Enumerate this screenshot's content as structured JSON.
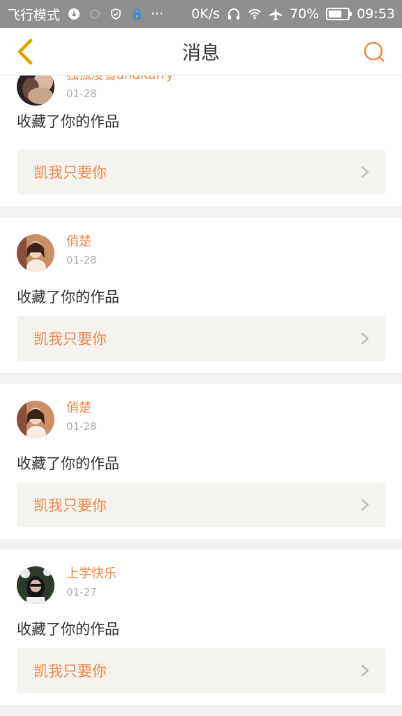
{
  "status_bar": {
    "mode": "飞行模式",
    "net_speed": "0K/s",
    "battery": "70%",
    "time": "09:53",
    "battery_level": 0.7
  },
  "header": {
    "title": "消息"
  },
  "colors": {
    "accent": "#f08a4b",
    "back_icon": "#f0b400"
  },
  "notifications": [
    {
      "user": "独孤凌雪andKarry",
      "date": "01-28",
      "action": "收藏了你的作品",
      "work": "凯我只要你",
      "avatar": "avatar-photo-dark"
    },
    {
      "user": "俏楚",
      "date": "01-28",
      "action": "收藏了你的作品",
      "work": "凯我只要你",
      "avatar": "avatar-photo-warm"
    },
    {
      "user": "俏楚",
      "date": "01-28",
      "action": "收藏了你的作品",
      "work": "凯我只要你",
      "avatar": "avatar-photo-warm"
    },
    {
      "user": "上学快乐",
      "date": "01-27",
      "action": "收藏了你的作品",
      "work": "凯我只要你",
      "avatar": "avatar-photo-glasses"
    }
  ]
}
